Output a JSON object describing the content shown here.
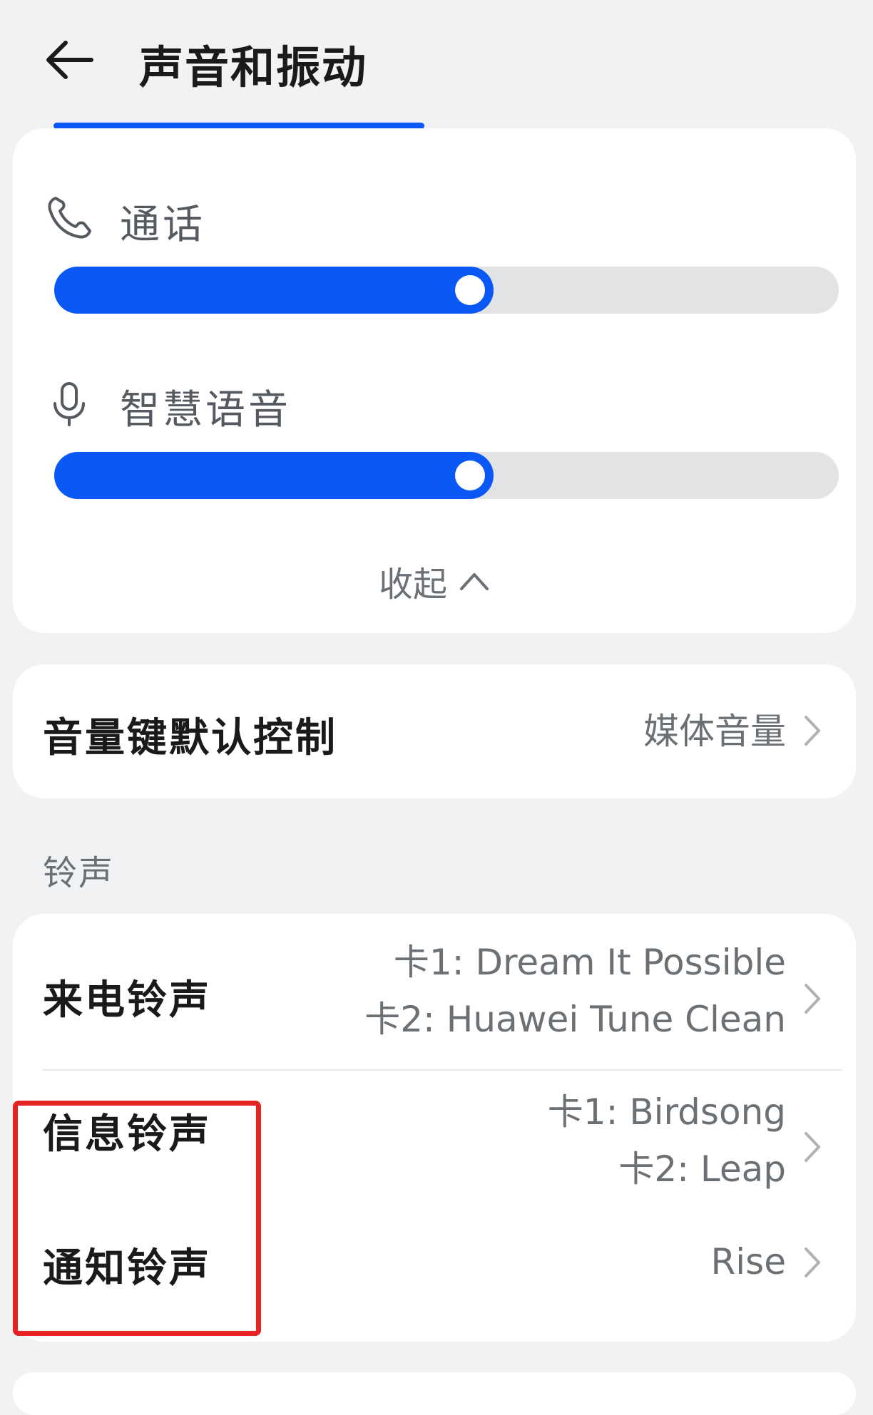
{
  "header": {
    "title": "声音和振动"
  },
  "volume": {
    "call": {
      "label": "通话",
      "level_percent": 56
    },
    "voice_assistant": {
      "label": "智慧语音",
      "level_percent": 56
    },
    "collapse_label": "收起"
  },
  "volume_key": {
    "label": "音量键默认控制",
    "value": "媒体音量"
  },
  "ringtones": {
    "section_label": "铃声",
    "incoming": {
      "label": "来电铃声",
      "sim1": "卡1: Dream It Possible",
      "sim2": "卡2: Huawei Tune Clean"
    },
    "message": {
      "label": "信息铃声",
      "sim1": "卡1: Birdsong",
      "sim2": "卡2: Leap"
    },
    "notification": {
      "label": "通知铃声",
      "value": "Rise"
    }
  },
  "colors": {
    "accent": "#0a59f7",
    "highlight": "#e52323",
    "background": "#f0f2f4"
  }
}
